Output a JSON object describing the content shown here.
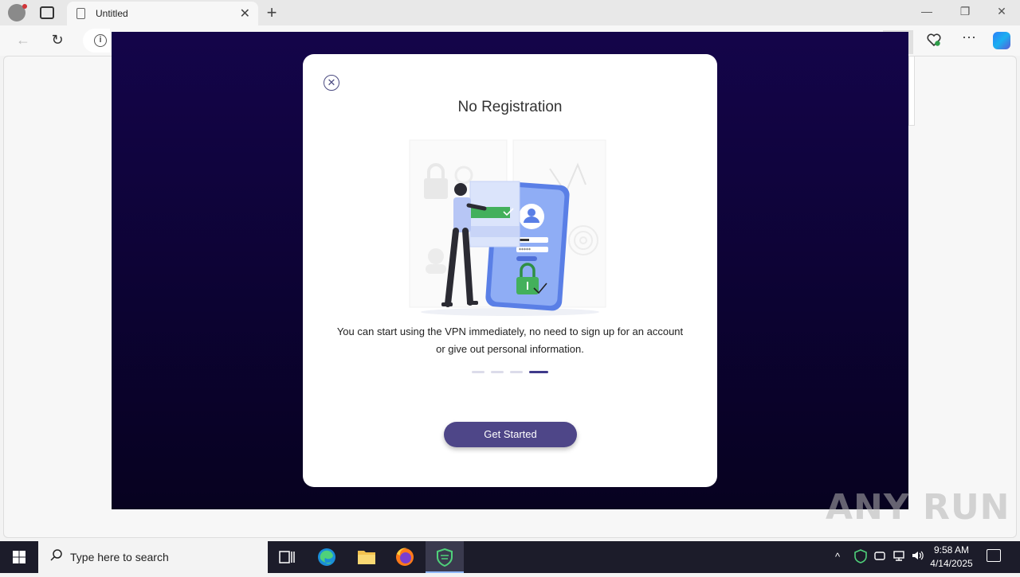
{
  "browser": {
    "tab_title": "Untitled",
    "tab_close": "✕",
    "new_tab": "+",
    "minimize": "—",
    "restore": "❐",
    "close": "✕",
    "back": "←",
    "reload": "↻",
    "info": "i",
    "more": "···"
  },
  "dialog": {
    "close_glyph": "✕",
    "title": "No Registration",
    "description": "You can start using the VPN immediately, no need to sign up for an account or give out personal information.",
    "pager": {
      "total": 4,
      "active": 4
    },
    "cta_label": "Get Started"
  },
  "watermark": "ANY RUN",
  "taskbar": {
    "search_placeholder": "Type here to search",
    "time": "9:58 AM",
    "date": "4/14/2025"
  },
  "colors": {
    "app_bg": "#0d0335",
    "cta": "#4e4688",
    "accent_green": "#4caf50",
    "phone_blue": "#7d9cf0"
  }
}
